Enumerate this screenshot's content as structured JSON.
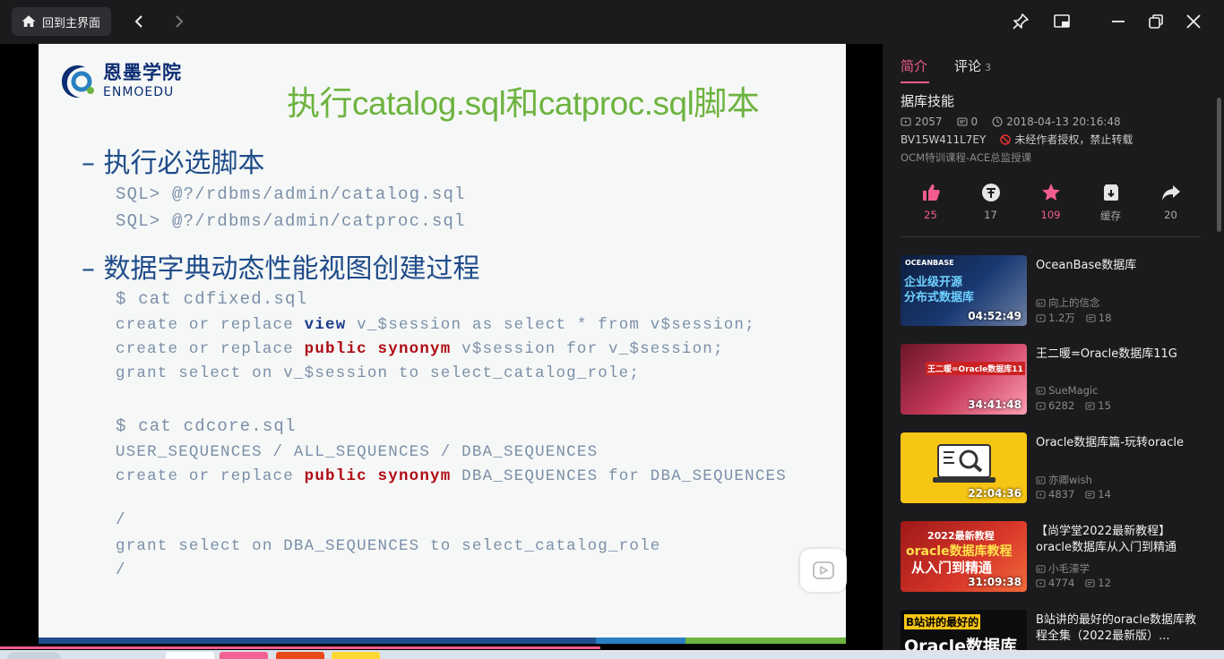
{
  "titlebar": {
    "home_label": "回到主界面"
  },
  "slide": {
    "logo_cn": "恩墨学院",
    "logo_en": "ENMOEDU",
    "title": "执行catalog.sql和catproc.sql脚本",
    "bullet1": "– 执行必选脚本",
    "code1": "SQL> @?/rdbms/admin/catalog.sql",
    "code2": "SQL> @?/rdbms/admin/catproc.sql",
    "bullet2": "– 数据字典动态性能视图创建过程",
    "code3": "$ cat cdfixed.sql",
    "code4": {
      "a": "create or replace ",
      "b": "view",
      "c": " v_$session as select * from v$session;"
    },
    "code5": {
      "a": "create or replace ",
      "b": "public synonym",
      "c": " v$session for v_$session;"
    },
    "code6": "grant select on v_$session to select_catalog_role;",
    "code7": "$ cat cdcore.sql",
    "code8": "USER_SEQUENCES / ALL_SEQUENCES / DBA_SEQUENCES",
    "code9": {
      "a": "create or replace ",
      "b": "public synonym",
      "c": " DBA_SEQUENCES for DBA_SEQUENCES"
    },
    "code10": "/",
    "code11": "grant select on DBA_SEQUENCES to select_catalog_role",
    "code12": "/"
  },
  "player": {
    "progress_fraction": 0.68
  },
  "side": {
    "tabs": [
      {
        "label": "简介",
        "active": true
      },
      {
        "label": "评论",
        "count": "3"
      }
    ],
    "video_title": "据库技能",
    "views": "2057",
    "danmaku": "0",
    "date": "2018-04-13 20:16:48",
    "bvid": "BV15W411L7EY",
    "notice": "未经作者授权，禁止转载",
    "description": "OCM特训课程-ACE总监授课",
    "actions": [
      {
        "icon": "like-icon",
        "count": "25"
      },
      {
        "icon": "coin-icon",
        "count": "17"
      },
      {
        "icon": "favorite-icon",
        "count": "109"
      },
      {
        "icon": "download-icon",
        "count": "缓存"
      },
      {
        "icon": "share-icon",
        "count": "20"
      }
    ],
    "recommendations": [
      {
        "title": "OceanBase数据库",
        "uploader": "向上的信念",
        "views": "1.2万",
        "danmaku": "18",
        "duration": "04:52:49",
        "thumb_text1": "OCEANBASE",
        "thumb_text2": "企业级开源",
        "thumb_text3": "分布式数据库"
      },
      {
        "title": "王二暖=Oracle数据库11G",
        "uploader": "SueMagic",
        "views": "6282",
        "danmaku": "15",
        "duration": "34:41:48",
        "thumb_text1": "王二暖=Oracle数据库11"
      },
      {
        "title": "Oracle数据库篇-玩转oracle",
        "uploader": "亦卿wish",
        "views": "4837",
        "danmaku": "14",
        "duration": "22:04:36"
      },
      {
        "title": "【尚学堂2022最新教程】oracle数据库从入门到精通",
        "uploader": "小毛濠学",
        "views": "4774",
        "danmaku": "12",
        "duration": "31:09:38",
        "thumb_text1": "2022最新教程",
        "thumb_text2": "oracle数据库教程",
        "thumb_text3": "从入门到精通"
      },
      {
        "title": "B站讲的最好的oracle数据库教程全集（2022最新版）...",
        "thumb_text1": "B站讲的最好的",
        "thumb_text2": "Oracle数据库"
      }
    ]
  },
  "colors": {
    "accent": "#f25d8e",
    "slide_title": "#6db33f",
    "bullet": "#1f4c8a",
    "keyword_red": "#b00a14",
    "keyword_blue": "#1a3c8a"
  }
}
